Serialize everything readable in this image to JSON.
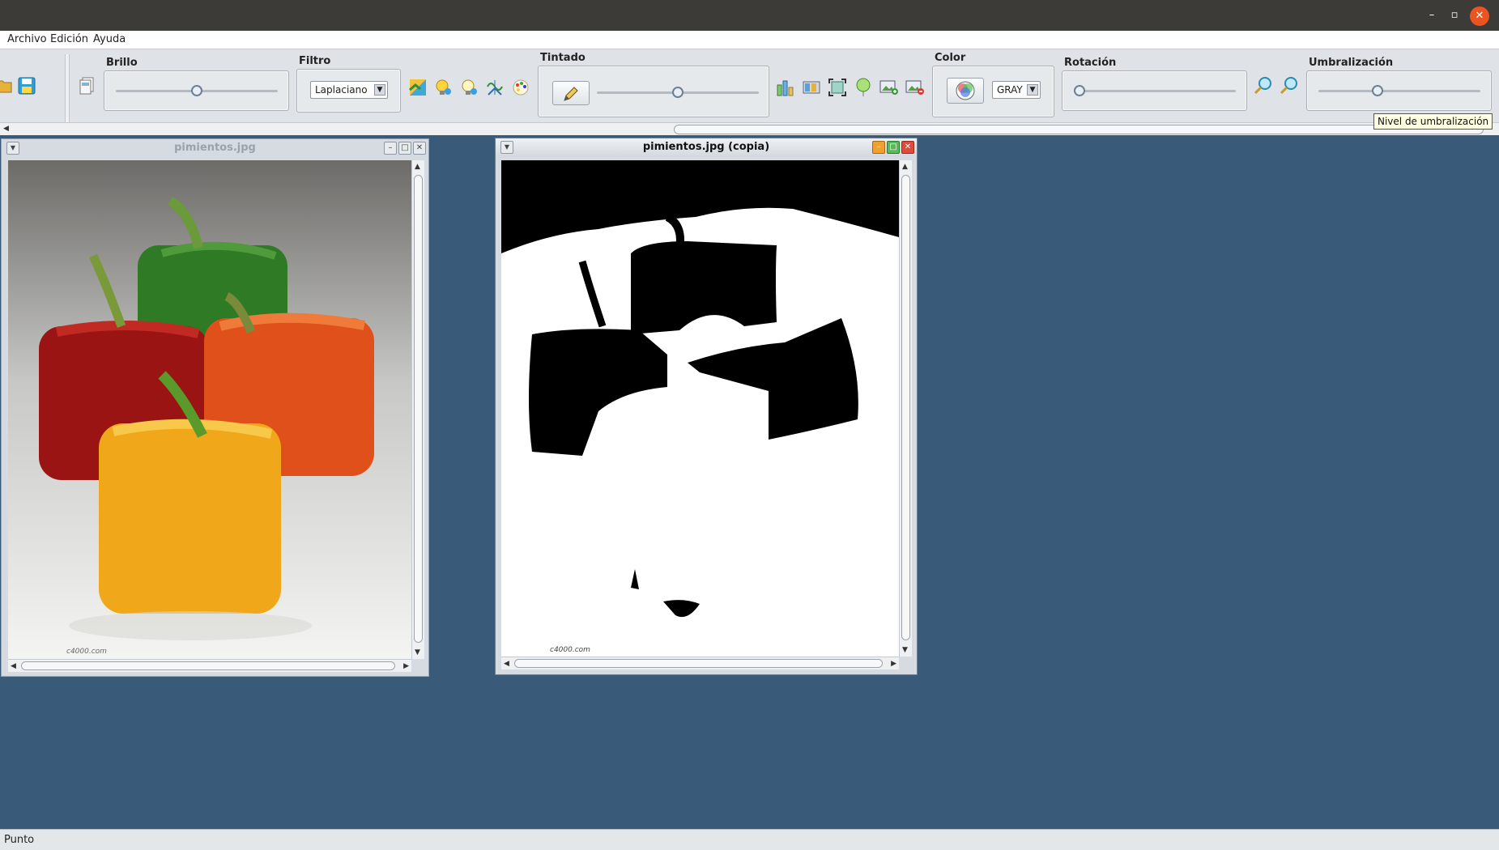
{
  "os_window": {
    "minimize": "–",
    "maximize": "▫",
    "close": "✕"
  },
  "menu": {
    "items": [
      "Archivo",
      "Edición",
      "Ayuda"
    ]
  },
  "toolbar": {
    "brillo": {
      "label": "Brillo",
      "slider_value_pct": 50
    },
    "filtro": {
      "label": "Filtro",
      "selected": "Laplaciano"
    },
    "tintado": {
      "label": "Tintado",
      "slider_value_pct": 50
    },
    "color": {
      "label": "Color",
      "selected": "GRAY"
    },
    "rotacion": {
      "label": "Rotación",
      "slider_value_pct": 0
    },
    "umbralizacion": {
      "label": "Umbralización",
      "slider_value_pct": 35,
      "tooltip": "Nivel de umbralización"
    },
    "icons": [
      "open-icon",
      "save-icon",
      "duplicate-icon",
      "sepia-icon",
      "light-bulb-icon",
      "light-bulb-dim-icon",
      "sine-wave-icon",
      "palette-icon",
      "pencil-icon",
      "histogram-icon",
      "bands-icon",
      "fullscreen-icon",
      "balloon-icon",
      "image-add-icon",
      "image-remove-icon",
      "color-wheel-icon",
      "zoom-in-icon",
      "zoom-out-icon"
    ]
  },
  "windows": [
    {
      "title": "pimientos.jpg",
      "active": false,
      "watermark": "c4000.com"
    },
    {
      "title": "pimientos.jpg (copia)",
      "active": true,
      "watermark": "c4000.com"
    }
  ],
  "status": {
    "text": "Punto"
  },
  "colors": {
    "desktop": "#3a5a7a",
    "os_close": "#e95420",
    "tooltip_bg": "#ffffe1"
  }
}
